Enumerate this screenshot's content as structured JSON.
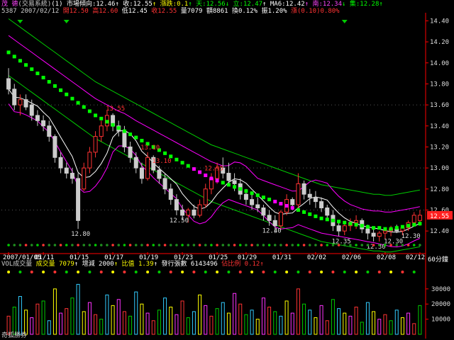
{
  "header": {
    "line1": [
      {
        "text": "茂  德",
        "color": "#ff44ff"
      },
      {
        "text": "(交易系統)",
        "color": "#cccccc"
      },
      {
        "text": "(1) 市場傾向:12.46",
        "color": "#ffffff"
      },
      {
        "text": "↑ 收:12.55",
        "color": "#ffffff"
      },
      {
        "text": "↑ 漲跌:0.1",
        "color": "#ffff00"
      },
      {
        "text": "↑ 天:12.56",
        "color": "#00ff00"
      },
      {
        "text": "↓ 立:12.47",
        "color": "#00ff00"
      },
      {
        "text": "↑ MA6:12.42",
        "color": "#ffffff"
      },
      {
        "text": "↑ 南:12.34",
        "color": "#ff44ff"
      },
      {
        "text": "↓ 集:12.28",
        "color": "#00ff00"
      },
      {
        "text": "↑",
        "color": "#00ff00"
      }
    ],
    "line2": [
      {
        "text": "5387 2007/02/12",
        "color": "#cccccc"
      },
      {
        "text": " 開12.50",
        "color": "#ff3333"
      },
      {
        "text": " 高12.60",
        "color": "#ff3333"
      },
      {
        "text": " 低12.45",
        "color": "#ffffff"
      },
      {
        "text": " 收12.55",
        "color": "#ff3333"
      },
      {
        "text": " 量7079",
        "color": "#ffffff"
      },
      {
        "text": " 額8861",
        "color": "#ffffff"
      },
      {
        "text": " 換0.12%",
        "color": "#ffffff"
      },
      {
        "text": " 振1.20%",
        "color": "#ffffff"
      },
      {
        "text": " 漲(0.10)0.80%",
        "color": "#ff3333"
      }
    ]
  },
  "vol_header": [
    {
      "text": "VOL成交量",
      "color": "#cccccc"
    },
    {
      "text": " 成交量 7079",
      "color": "#ffff00"
    },
    {
      "text": "↑ 增減 2000",
      "color": "#ffffff"
    },
    {
      "text": "↑ 比值 1.39",
      "color": "#ffff00"
    },
    {
      "text": "↑ 發行張數 6143496",
      "color": "#ffffff"
    },
    {
      "text": " 佔比例 0.12",
      "color": "#ff3333"
    },
    {
      "text": "↑",
      "color": "#ff3333"
    }
  ],
  "footer": {
    "broker": "奇狐勝券",
    "period": "60分鐘"
  },
  "last_price_tag": "12.55",
  "colors": {
    "up": "#ff3333",
    "down": "#cccccc",
    "trend": "#00ff00",
    "trend_highlight": "#ff00ff",
    "band": "#ff00ff",
    "outer_band": "#00cc00",
    "ma": "#ffffff",
    "grid": "#555555",
    "axis": "#ff0000"
  },
  "chart_data": {
    "type": "candlestick",
    "title": "",
    "price_axis": {
      "ticks": [
        "14.40",
        "14.20",
        "14.00",
        "13.80",
        "13.60",
        "13.40",
        "13.20",
        "13.00",
        "12.80",
        "12.60",
        "12.40"
      ],
      "range": [
        12.32,
        14.45
      ]
    },
    "volume_axis": {
      "ticks": [
        "30000",
        "20000",
        "10000"
      ]
    },
    "x_tick_labels": [
      "2007/01/05",
      "01/11",
      "01/15",
      "01/17",
      "01/19",
      "01/23",
      "01/25",
      "01/29",
      "01/31",
      "02/02",
      "02/06",
      "02/08",
      "02/12"
    ],
    "price_annotations": [
      "13.55",
      "13.10",
      "12.80",
      "12.50",
      "13.10",
      "12.40",
      "12.95",
      "12.35",
      "12.30",
      "12.30",
      "12.30"
    ],
    "candles": [
      [
        13.85,
        13.95,
        13.7,
        13.75
      ],
      [
        13.75,
        13.8,
        13.55,
        13.6
      ],
      [
        13.6,
        13.7,
        13.5,
        13.65
      ],
      [
        13.65,
        13.7,
        13.55,
        13.58
      ],
      [
        13.6,
        13.65,
        13.45,
        13.5
      ],
      [
        13.5,
        13.55,
        13.4,
        13.45
      ],
      [
        13.45,
        13.5,
        13.35,
        13.4
      ],
      [
        13.4,
        13.45,
        13.25,
        13.3
      ],
      [
        13.3,
        13.32,
        13.05,
        13.1
      ],
      [
        13.1,
        13.15,
        12.95,
        13.0
      ],
      [
        13.0,
        13.05,
        12.9,
        12.95
      ],
      [
        12.95,
        13.0,
        12.85,
        12.9
      ],
      [
        12.9,
        12.95,
        12.42,
        12.5
      ],
      [
        12.8,
        13.05,
        12.78,
        13.0
      ],
      [
        13.0,
        13.2,
        12.95,
        13.15
      ],
      [
        13.15,
        13.35,
        13.1,
        13.3
      ],
      [
        13.3,
        13.45,
        13.25,
        13.4
      ],
      [
        13.4,
        13.55,
        13.35,
        13.5
      ],
      [
        13.5,
        13.52,
        13.35,
        13.4
      ],
      [
        13.4,
        13.45,
        13.3,
        13.35
      ],
      [
        13.35,
        13.4,
        13.15,
        13.2
      ],
      [
        13.2,
        13.25,
        13.05,
        13.1
      ],
      [
        13.1,
        13.15,
        12.95,
        13.0
      ],
      [
        13.0,
        13.05,
        12.85,
        12.9
      ],
      [
        12.9,
        13.15,
        12.88,
        13.1
      ],
      [
        13.1,
        13.12,
        12.95,
        12.98
      ],
      [
        12.98,
        13.02,
        12.85,
        12.9
      ],
      [
        12.9,
        12.95,
        12.75,
        12.8
      ],
      [
        12.8,
        12.85,
        12.65,
        12.7
      ],
      [
        12.7,
        12.75,
        12.55,
        12.6
      ],
      [
        12.6,
        12.65,
        12.5,
        12.55
      ],
      [
        12.55,
        12.62,
        12.48,
        12.6
      ],
      [
        12.6,
        12.65,
        12.52,
        12.55
      ],
      [
        12.55,
        12.7,
        12.53,
        12.65
      ],
      [
        12.65,
        12.85,
        12.62,
        12.8
      ],
      [
        12.8,
        12.95,
        12.75,
        12.9
      ],
      [
        12.9,
        13.05,
        12.85,
        13.0
      ],
      [
        13.0,
        13.1,
        12.9,
        12.95
      ],
      [
        12.95,
        13.05,
        12.85,
        12.88
      ],
      [
        12.88,
        12.95,
        12.78,
        12.85
      ],
      [
        12.85,
        12.9,
        12.7,
        12.75
      ],
      [
        12.75,
        12.8,
        12.65,
        12.7
      ],
      [
        12.7,
        12.75,
        12.6,
        12.65
      ],
      [
        12.65,
        12.72,
        12.58,
        12.62
      ],
      [
        12.62,
        12.65,
        12.5,
        12.55
      ],
      [
        12.55,
        12.6,
        12.45,
        12.5
      ],
      [
        12.5,
        12.55,
        12.38,
        12.45
      ],
      [
        12.45,
        12.6,
        12.42,
        12.58
      ],
      [
        12.58,
        12.75,
        12.55,
        12.7
      ],
      [
        12.7,
        12.72,
        12.6,
        12.65
      ],
      [
        12.65,
        12.95,
        12.62,
        12.85
      ],
      [
        12.85,
        12.88,
        12.7,
        12.75
      ],
      [
        12.75,
        12.8,
        12.65,
        12.72
      ],
      [
        12.72,
        12.78,
        12.62,
        12.68
      ],
      [
        12.68,
        12.72,
        12.58,
        12.62
      ],
      [
        12.62,
        12.65,
        12.5,
        12.55
      ],
      [
        12.55,
        12.6,
        12.4,
        12.45
      ],
      [
        12.45,
        12.5,
        12.35,
        12.4
      ],
      [
        12.4,
        12.48,
        12.36,
        12.45
      ],
      [
        12.45,
        12.52,
        12.4,
        12.48
      ],
      [
        12.48,
        12.55,
        12.42,
        12.5
      ],
      [
        12.5,
        12.52,
        12.38,
        12.42
      ],
      [
        12.42,
        12.46,
        12.32,
        12.38
      ],
      [
        12.38,
        12.42,
        12.3,
        12.35
      ],
      [
        12.35,
        12.4,
        12.3,
        12.38
      ],
      [
        12.38,
        12.42,
        12.32,
        12.4
      ],
      [
        12.4,
        12.45,
        12.35,
        12.42
      ],
      [
        12.42,
        12.46,
        12.38,
        12.4
      ],
      [
        12.4,
        12.45,
        12.36,
        12.43
      ],
      [
        12.43,
        12.5,
        12.4,
        12.48
      ],
      [
        12.48,
        12.58,
        12.45,
        12.55
      ],
      [
        12.5,
        12.6,
        12.45,
        12.55
      ]
    ],
    "trend_values": [
      14.1,
      14.06,
      14.02,
      13.98,
      13.94,
      13.9,
      13.86,
      13.82,
      13.78,
      13.74,
      13.7,
      13.66,
      13.62,
      13.58,
      13.54,
      13.5,
      13.47,
      13.44,
      13.41,
      13.38,
      13.35,
      13.32,
      13.29,
      13.26,
      13.23,
      13.2,
      13.17,
      13.14,
      13.11,
      13.08,
      13.05,
      13.02,
      12.99,
      12.96,
      12.93,
      12.9,
      12.88,
      12.86,
      12.84,
      12.82,
      12.8,
      12.78,
      12.76,
      12.74,
      12.72,
      12.7,
      12.68,
      12.66,
      12.64,
      12.62,
      12.6,
      12.58,
      12.56,
      12.54,
      12.52,
      12.51,
      12.5,
      12.49,
      12.48,
      12.47,
      12.46,
      12.45,
      12.44,
      12.43,
      12.43,
      12.42,
      12.42,
      12.43,
      12.44,
      12.45,
      12.46,
      12.47
    ],
    "volume": [
      12000,
      18000,
      25000,
      16000,
      11000,
      20000,
      22000,
      9000,
      30000,
      14000,
      17000,
      24000,
      33000,
      15000,
      21000,
      13000,
      10000,
      26000,
      19000,
      23000,
      15000,
      12000,
      28000,
      20000,
      14000,
      9000,
      16000,
      24000,
      18000,
      13000,
      22000,
      11000,
      15000,
      26000,
      19000,
      12000,
      17000,
      21000,
      14000,
      27000,
      20000,
      13000,
      16000,
      10000,
      24000,
      18000,
      15000,
      12000,
      22000,
      14000,
      30000,
      20000,
      16000,
      11000,
      19000,
      9000,
      23000,
      17000,
      14000,
      12000,
      18000,
      8000,
      21000,
      15000,
      10000,
      13000,
      9000,
      16000,
      11000,
      14000,
      7079,
      19000
    ]
  }
}
